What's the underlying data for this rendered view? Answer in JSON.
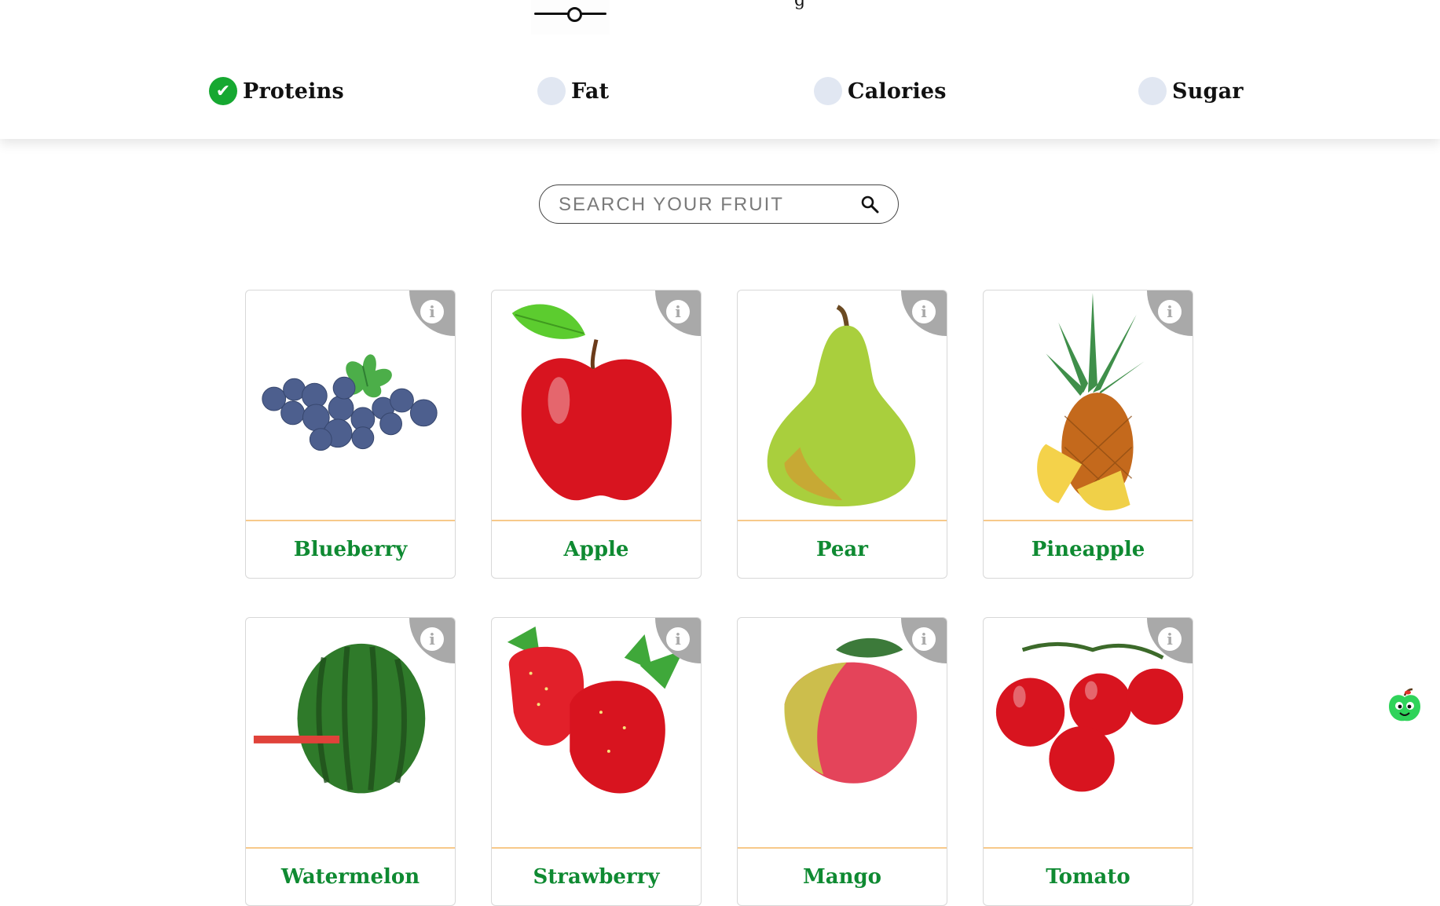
{
  "header": {
    "title_fragment": "g",
    "slider_value": 0.5,
    "filters": [
      {
        "label": "Proteins",
        "checked": true,
        "check_glyph": "✔"
      },
      {
        "label": "Fat",
        "checked": false
      },
      {
        "label": "Calories",
        "checked": false
      },
      {
        "label": "Sugar",
        "checked": false
      }
    ]
  },
  "search": {
    "placeholder": "SEARCH YOUR FRUIT",
    "value": "",
    "icon": "search-icon"
  },
  "fruits": [
    {
      "name": "Blueberry"
    },
    {
      "name": "Apple"
    },
    {
      "name": "Pear"
    },
    {
      "name": "Pineapple"
    },
    {
      "name": "Watermelon"
    },
    {
      "name": "Strawberry"
    },
    {
      "name": "Mango"
    },
    {
      "name": "Tomato"
    }
  ],
  "info_glyph": "i",
  "colors": {
    "accent_green": "#16a831",
    "fruit_name_green": "#0f8a32",
    "card_divider": "#f7c98a",
    "info_tab": "#a9a9a9",
    "radio_unchecked": "#e1e7f2"
  }
}
